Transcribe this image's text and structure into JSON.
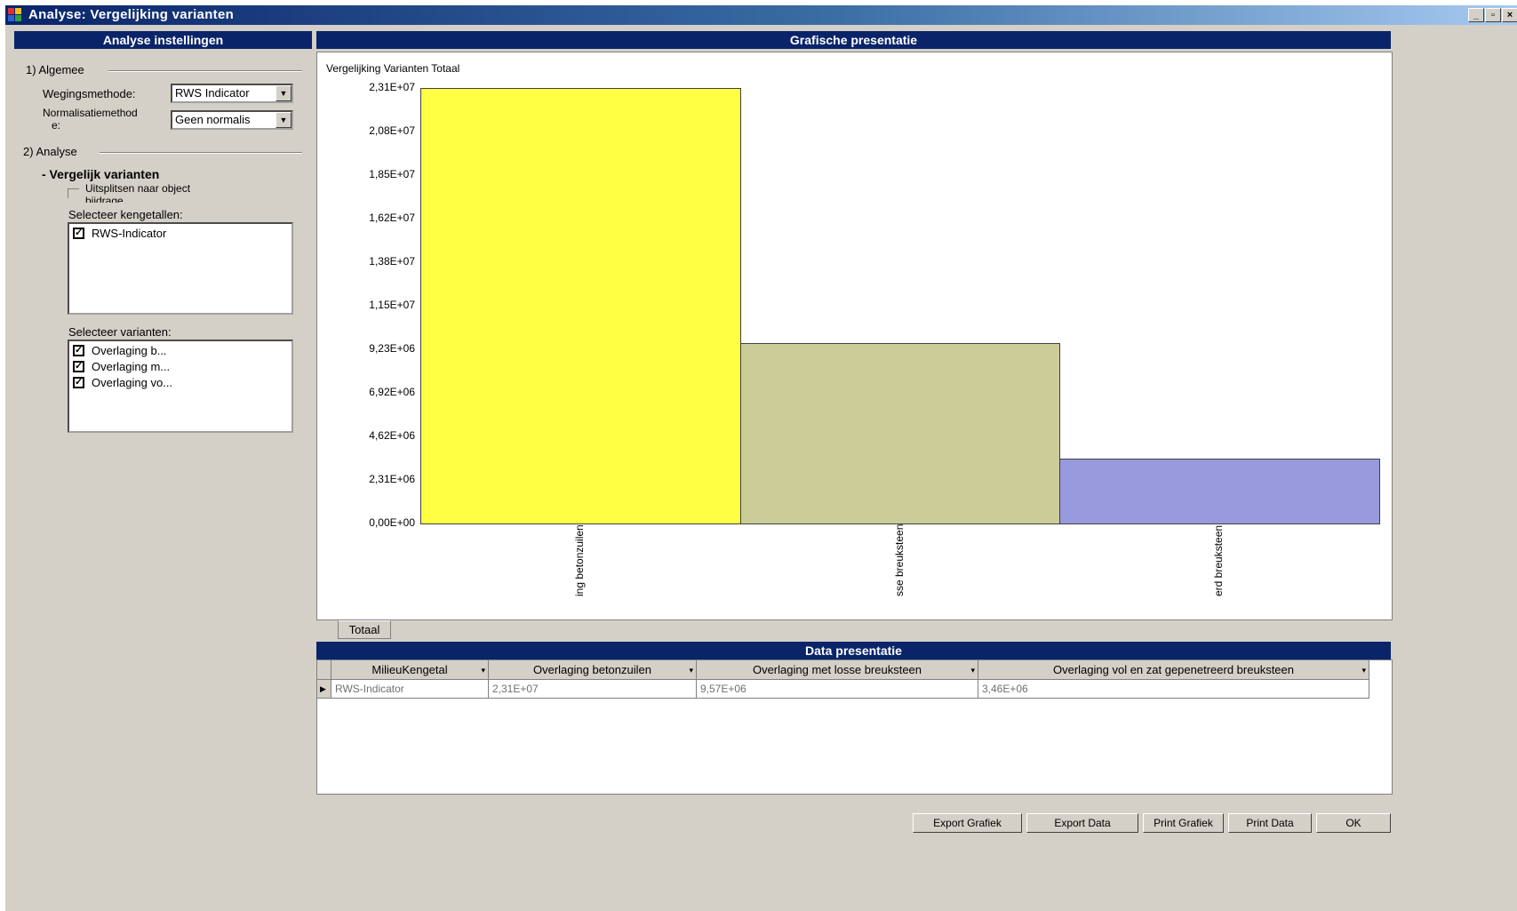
{
  "window": {
    "title": "Analyse: Vergelijking varianten",
    "buttons": {
      "minimize": "_",
      "maximize": "▫",
      "close": "×"
    }
  },
  "settings_panel": {
    "header": "Analyse instellingen",
    "group1_label": "1) Algemee",
    "weighting_label": "Wegingsmethode:",
    "weighting_value": "RWS Indicator",
    "normalization_label_line1": "Normalisatiemethod",
    "normalization_label_line2": "e:",
    "normalization_value": "Geen normalis",
    "group2_label": "2) Analyse",
    "compare_label": "- Vergelijk varianten",
    "split_checkbox_line1": "Uitsplitsen naar object",
    "split_checkbox_line2": "bijdrage",
    "kpi_label": "Selecteer kengetallen:",
    "kpi_items": [
      "RWS-Indicator"
    ],
    "variants_label": "Selecteer varianten:",
    "variant_items": [
      "Overlaging b...",
      "Overlaging m...",
      "Overlaging vo..."
    ]
  },
  "chart_panel": {
    "header": "Grafische presentatie",
    "tab_label": "Totaal"
  },
  "chart_data": {
    "type": "bar",
    "title": "Vergelijking Varianten Totaal",
    "xlabel": "",
    "ylabel": "",
    "categories": [
      "ing betonzuilen",
      "sse breuksteen",
      "erd breuksteen"
    ],
    "values": [
      23100000,
      9570000,
      3460000
    ],
    "colors": [
      "#ffff44",
      "#cccc99",
      "#9999dd"
    ],
    "ylim": [
      0,
      23100000
    ],
    "yticks": [
      "0,00E+00",
      "2,31E+06",
      "4,62E+06",
      "6,92E+06",
      "9,23E+06",
      "1,15E+07",
      "1,38E+07",
      "1,62E+07",
      "1,85E+07",
      "2,08E+07",
      "2,31E+07"
    ],
    "grid": false,
    "legend": "none"
  },
  "data_panel": {
    "header": "Data presentatie",
    "columns": [
      "MilieuKengetal",
      "Overlaging betonzuilen",
      "Overlaging met losse breuksteen",
      "Overlaging vol en zat gepenetreerd breuksteen"
    ],
    "rows": [
      [
        "RWS-Indicator",
        "2,31E+07",
        "9,57E+06",
        "3,46E+06"
      ]
    ]
  },
  "footer_buttons": {
    "export_chart": "Export Grafiek",
    "export_data": "Export Data",
    "print_chart": "Print Grafiek",
    "print_data": "Print Data",
    "ok": "OK"
  }
}
